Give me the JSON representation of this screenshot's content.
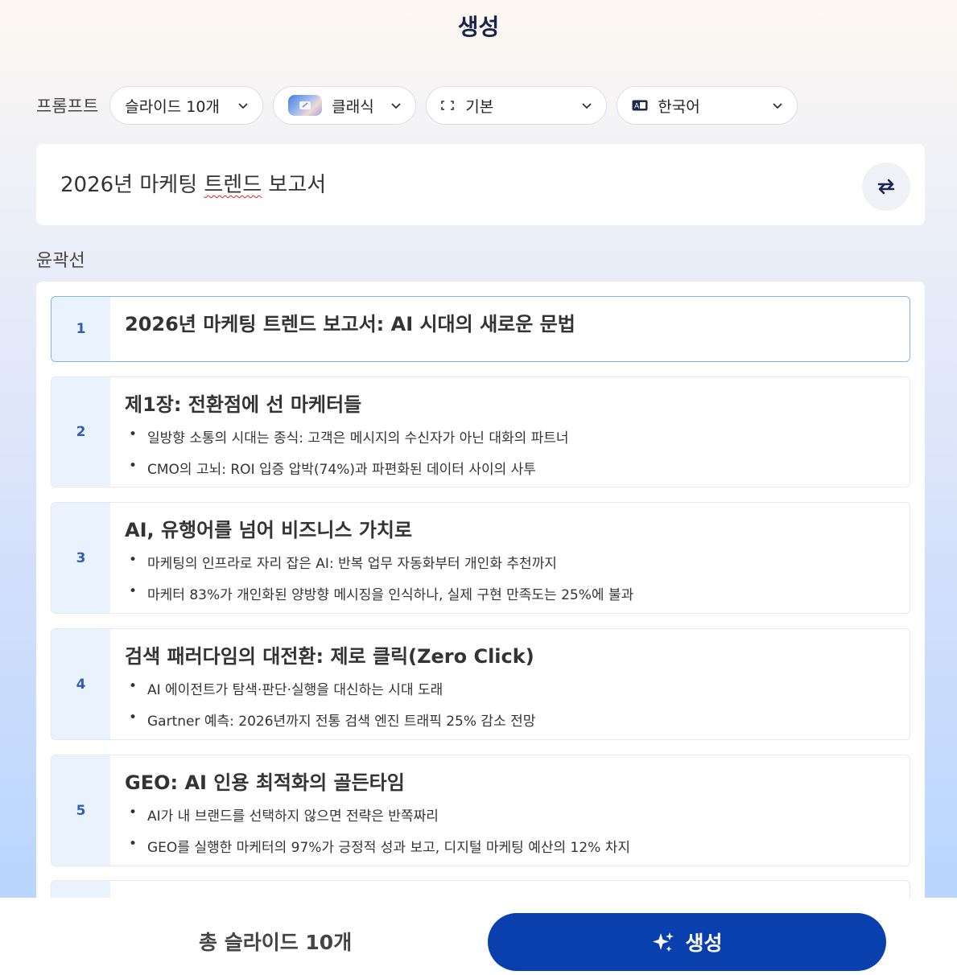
{
  "header": {
    "title": "생성"
  },
  "controls": {
    "prompt_label": "프롬프트",
    "slides": "슬라이드 10개",
    "theme": "클래식",
    "size": "기본",
    "language": "한국어"
  },
  "prompt": {
    "text_before": "2026년 마케팅 ",
    "text_misspelled": "트렌드",
    "text_after": " 보고서"
  },
  "outline": {
    "label": "윤곽선",
    "cards": [
      {
        "num": "1",
        "title": "2026년 마케팅 트렌드 보고서: AI 시대의 새로운 문법",
        "bullets": []
      },
      {
        "num": "2",
        "title": "제1장: 전환점에 선 마케터들",
        "bullets": [
          "일방향 소통의 시대는 종식: 고객은 메시지의 수신자가 아닌 대화의 파트너",
          "CMO의 고뇌: ROI 입증 압박(74%)과 파편화된 데이터 사이의 사투"
        ]
      },
      {
        "num": "3",
        "title": "AI, 유행어를 넘어 비즈니스 가치로",
        "bullets": [
          "마케팅의 인프라로 자리 잡은 AI: 반복 업무 자동화부터 개인화 추천까지",
          "마케터 83%가 개인화된 양방향 메시징을 인식하나, 실제 구현 만족도는 25%에 불과"
        ]
      },
      {
        "num": "4",
        "title": "검색 패러다임의 대전환: 제로 클릭(Zero Click)",
        "bullets": [
          "AI 에이전트가 탐색·판단·실행을 대신하는 시대 도래",
          "Gartner 예측: 2026년까지 전통 검색 엔진 트래픽 25% 감소 전망"
        ]
      },
      {
        "num": "5",
        "title": "GEO: AI 인용 최적화의 골든타임",
        "bullets": [
          "AI가 내 브랜드를 선택하지 않으면 전략은 반쪽짜리",
          "GEO를 실행한 마케터의 97%가 긍정적 성과 보고, 디지털 마케팅 예산의 12% 차지"
        ]
      }
    ]
  },
  "footer": {
    "total": "총 슬라이드 10개",
    "generate_label": "생성"
  },
  "colors": {
    "primary": "#0a3fae",
    "accent_num": "#2f5fae"
  }
}
